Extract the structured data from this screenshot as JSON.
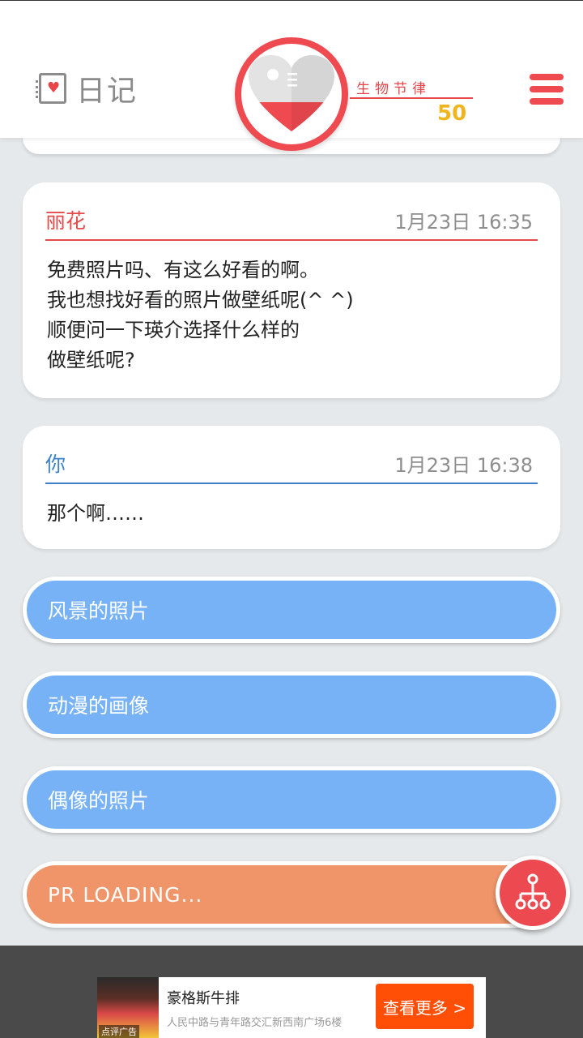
{
  "header": {
    "diary_label": "日记",
    "bio_label": "生物节律",
    "bio_value": "50",
    "heart_fill_percent": 40
  },
  "messages": [
    {
      "author": "丽花",
      "time": "1月23日  16:35",
      "text": "免费照片吗、有这么好看的啊。\n我也想找好看的照片做壁纸呢(^ ^)\n顺便问一下瑛介选择什么样的\n做壁纸呢?"
    },
    {
      "author": "你",
      "time": "1月23日  16:38",
      "text": "那个啊……"
    }
  ],
  "options": [
    {
      "label": "风景的照片"
    },
    {
      "label": "动漫的画像"
    },
    {
      "label": "偶像的照片"
    },
    {
      "label": "PR LOADING..."
    }
  ],
  "ad": {
    "title": "豪格斯牛排",
    "subtitle": "人民中路与青年路交汇新西南广场6楼",
    "button": "查看更多 >",
    "image_label": "点评广告"
  },
  "colors": {
    "accent_red": "#ee4a50",
    "bio_value": "#f0b41c",
    "you_blue": "#3b82c9",
    "option_blue": "#76b2f5",
    "option_orange": "#f0956a",
    "ad_button": "#ff4e06"
  },
  "icons": {
    "diary": "diary-heart-icon",
    "badge": "heart-icon",
    "menu": "hamburger-menu-icon",
    "fab": "tree-network-icon"
  }
}
